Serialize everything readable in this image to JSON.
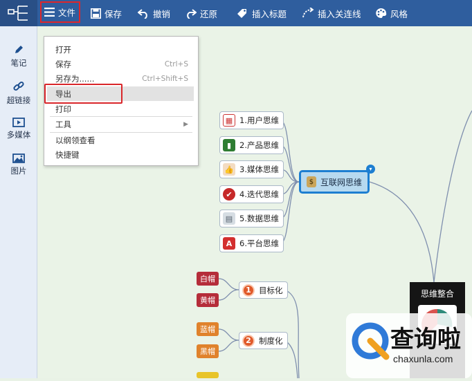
{
  "toolbar": {
    "file": "文件",
    "save": "保存",
    "undo": "撤销",
    "redo": "还原",
    "insert_label": "插入标题",
    "insert_link": "插入关连线",
    "style": "风格"
  },
  "sidebar": {
    "items": [
      {
        "label": "笔记",
        "icon": "pencil-icon"
      },
      {
        "label": "超链接",
        "icon": "link-icon"
      },
      {
        "label": "多媒体",
        "icon": "media-icon"
      },
      {
        "label": "图片",
        "icon": "image-icon"
      }
    ]
  },
  "menu": {
    "items": [
      {
        "label": "打开",
        "shortcut": ""
      },
      {
        "label": "保存",
        "shortcut": "Ctrl+S"
      },
      {
        "label": "另存为......",
        "shortcut": "Ctrl+Shift+S"
      },
      {
        "label": "导出",
        "shortcut": ""
      },
      {
        "label": "打印",
        "shortcut": ""
      },
      {
        "label": "工具",
        "shortcut": ""
      },
      {
        "label": "以纲领查看",
        "shortcut": ""
      },
      {
        "label": "快捷键",
        "shortcut": ""
      }
    ]
  },
  "mindmap": {
    "center": "互联网思维",
    "children": [
      {
        "label": "1.用户思维",
        "color": "#d9534f"
      },
      {
        "label": "2.产品思维",
        "color": "#2e7d32"
      },
      {
        "label": "3.媒体思维",
        "color": "#d8a874"
      },
      {
        "label": "4.迭代思维",
        "color": "#c62828"
      },
      {
        "label": "5.数据思维",
        "color": "#8a9aa8"
      },
      {
        "label": "6.平台思维",
        "color": "#d32f2f"
      }
    ],
    "goals": [
      {
        "num": "1",
        "label": "目标化"
      },
      {
        "num": "2",
        "label": "制度化"
      }
    ],
    "tags": [
      {
        "label": "白帽",
        "color": "#b52d3a"
      },
      {
        "label": "黄帽",
        "color": "#b52d3a"
      },
      {
        "label": "蓝帽",
        "color": "#e0822c"
      },
      {
        "label": "黑帽",
        "color": "#e0822c"
      }
    ],
    "summary": "思维整合"
  },
  "watermark": {
    "brand": "查询啦",
    "site": "chaxunla.com"
  },
  "colors": {
    "toolbar": "#2f5e9e",
    "highlight_box": "#d9262a",
    "center_border": "#1d7ed1"
  }
}
